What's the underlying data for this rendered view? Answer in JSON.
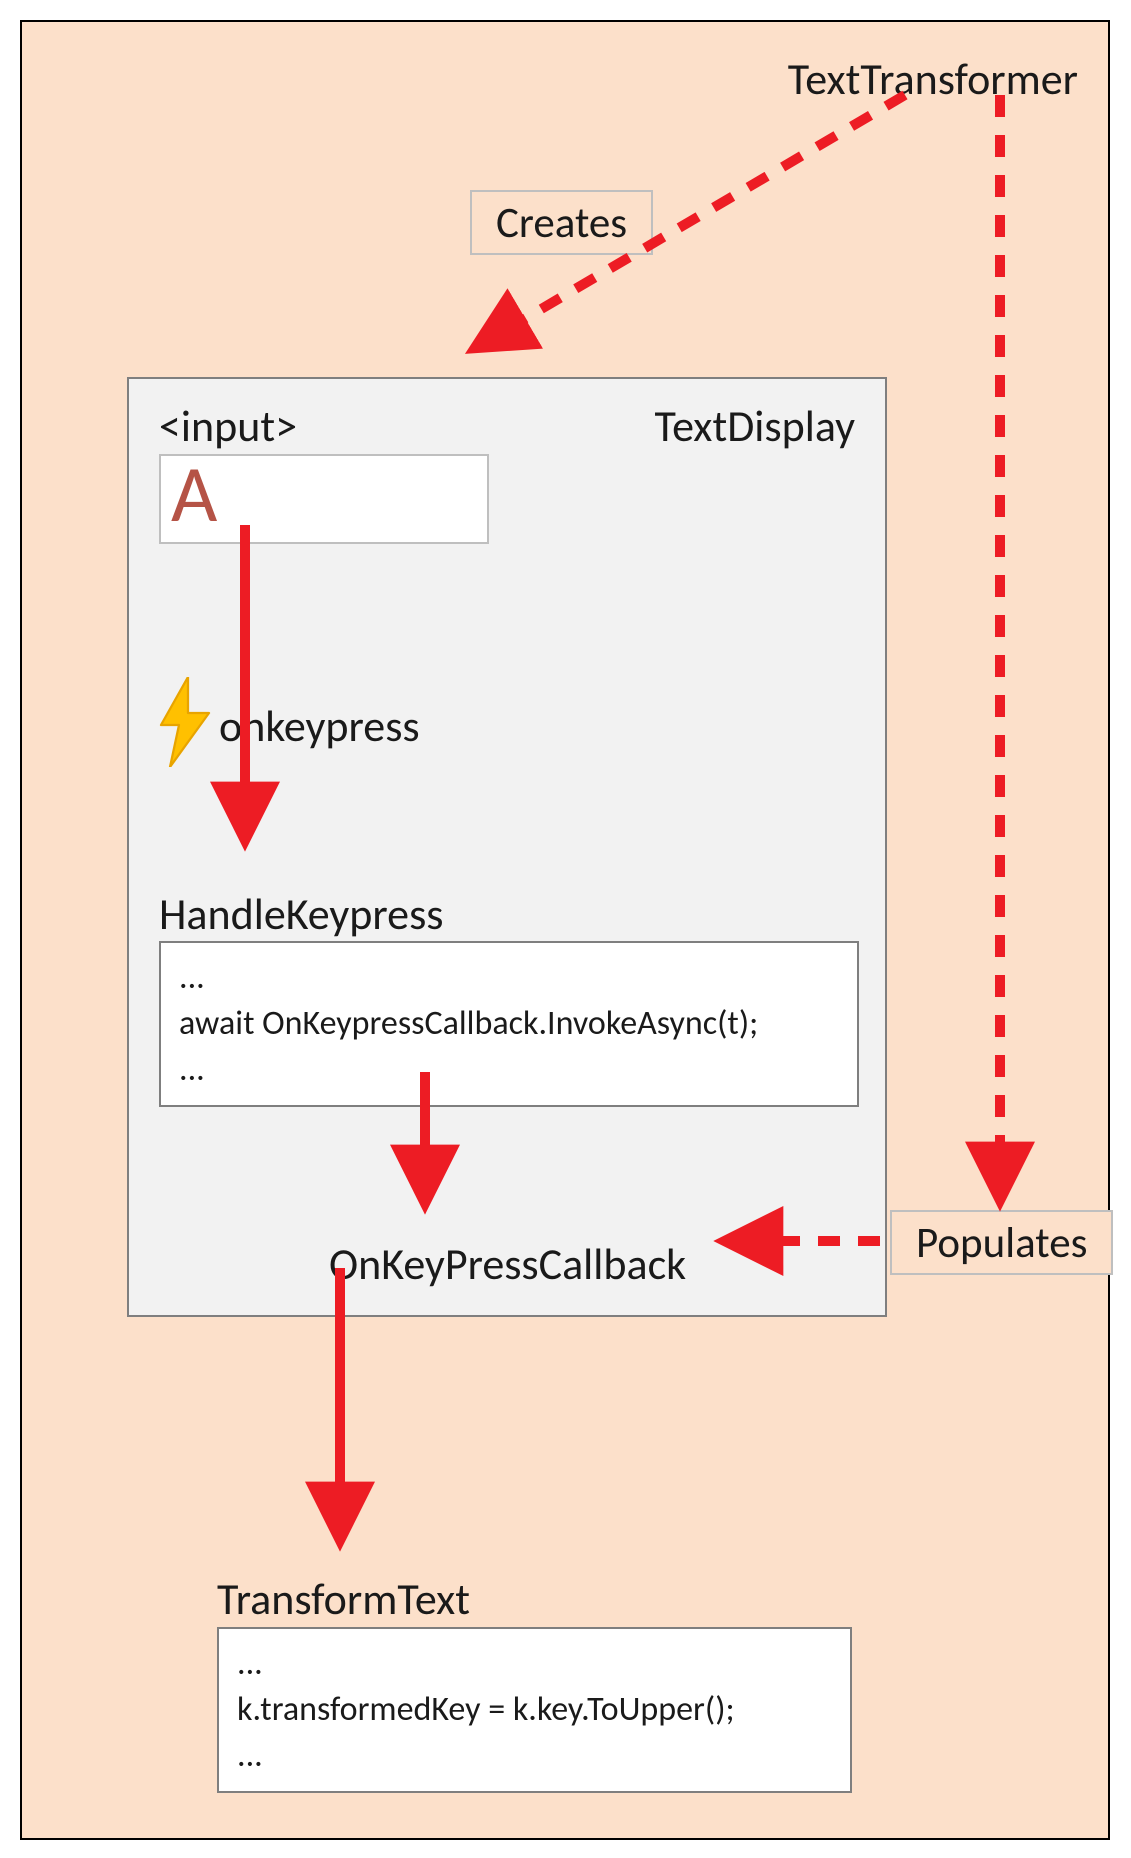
{
  "outer": {
    "title": "TextTransformer"
  },
  "inner": {
    "title": "TextDisplay",
    "input_tag_label": "<input>",
    "input_value": "A",
    "event_name": "onkeypress",
    "handler_name": "HandleKeypress",
    "handler_code": "...\nawait OnKeypressCallback.InvokeAsync(t);\n...",
    "callback_name": "OnKeyPressCallback"
  },
  "transform": {
    "name": "TransformText",
    "code": "...\nk.transformedKey = k.key.ToUpper();\n..."
  },
  "relations": {
    "creates": "Creates",
    "populates": "Populates"
  },
  "icons": {
    "bolt": "bolt-icon"
  },
  "colors": {
    "outer_bg": "#fce0ca",
    "inner_bg": "#f2f2f2",
    "arrow": "#ed1c24",
    "input_letter": "#B55346"
  }
}
